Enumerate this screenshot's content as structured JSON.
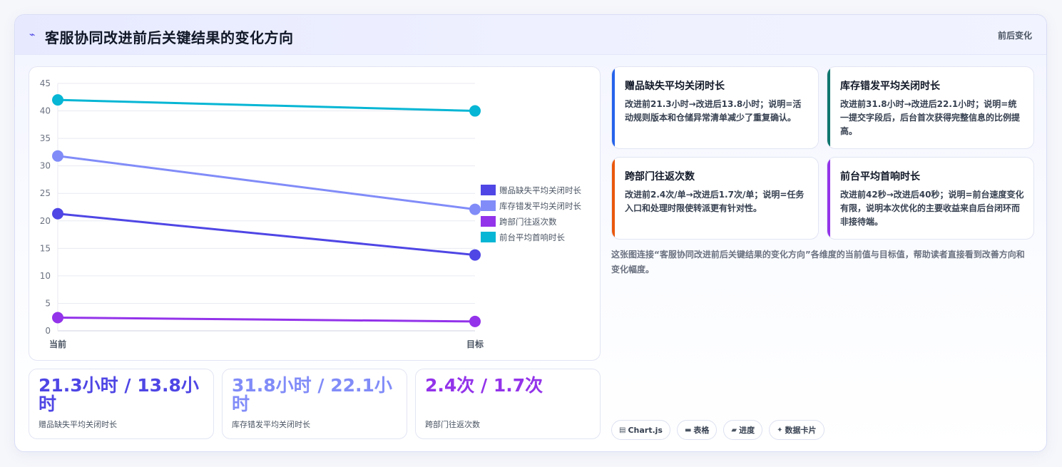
{
  "header": {
    "icon": "wave-icon",
    "title": "客服协同改进前后关键结果的变化方向",
    "tag": "前后变化"
  },
  "chart_data": {
    "type": "line",
    "categories": [
      "当前",
      "目标"
    ],
    "ylim": [
      0,
      45
    ],
    "yticks": [
      0,
      5,
      10,
      15,
      20,
      25,
      30,
      35,
      40,
      45
    ],
    "grid": true,
    "legend_position": "right",
    "series": [
      {
        "name": "赠品缺失平均关闭时长",
        "values": [
          21.3,
          13.8
        ],
        "color": "#4f46e5"
      },
      {
        "name": "库存错发平均关闭时长",
        "values": [
          31.8,
          22.1
        ],
        "color": "#818cf8"
      },
      {
        "name": "跨部门往返次数",
        "values": [
          2.4,
          1.7
        ],
        "color": "#9333ea"
      },
      {
        "name": "前台平均首响时长",
        "values": [
          42,
          40
        ],
        "color": "#06b6d4"
      }
    ]
  },
  "stats": [
    {
      "value": "21.3小时 / 13.8小时",
      "label": "赠品缺失平均关闭时长",
      "color": "#4f46e5"
    },
    {
      "value": "31.8小时 / 22.1小时",
      "label": "库存错发平均关闭时长",
      "color": "#818cf8"
    },
    {
      "value": "2.4次 / 1.7次",
      "label": "跨部门往返次数",
      "color": "#9333ea"
    }
  ],
  "cards": [
    {
      "title": "赠品缺失平均关闭时长",
      "body": "改进前21.3小时→改进后13.8小时；说明=活动规则版本和仓储异常清单减少了重复确认。",
      "color": "#2563eb"
    },
    {
      "title": "库存错发平均关闭时长",
      "body": "改进前31.8小时→改进后22.1小时；说明=统一提交字段后，后台首次获得完整信息的比例提高。",
      "color": "#0f766e"
    },
    {
      "title": "跨部门往返次数",
      "body": "改进前2.4次/单→改进后1.7次/单；说明=任务入口和处理时限使转派更有针对性。",
      "color": "#ea580c"
    },
    {
      "title": "前台平均首响时长",
      "body": "改进前42秒→改进后40秒；说明=前台速度变化有限，说明本次优化的主要收益来自后台闭环而非接待端。",
      "color": "#9333ea"
    }
  ],
  "note": "这张图连接“客服协同改进前后关键结果的变化方向”各维度的当前值与目标值，帮助读者直接看到改善方向和变化幅度。",
  "chips": [
    {
      "icon": "chart-icon",
      "glyph": "▤",
      "label": "Chart.js"
    },
    {
      "icon": "table-icon",
      "glyph": "▬",
      "label": "表格"
    },
    {
      "icon": "progress-icon",
      "glyph": "▰",
      "label": "进度"
    },
    {
      "icon": "sparkle-icon",
      "glyph": "✦",
      "label": "数据卡片"
    }
  ]
}
